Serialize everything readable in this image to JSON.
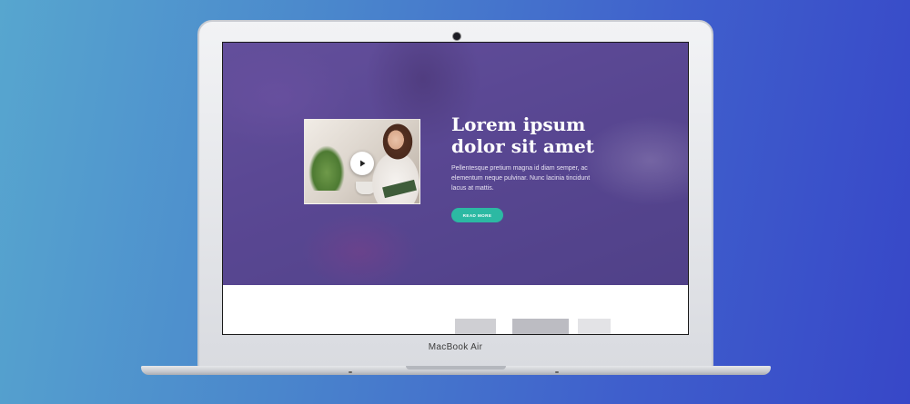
{
  "device": {
    "brand_label": "MacBook Air"
  },
  "hero": {
    "title_line1": "Lorem ipsum",
    "title_line2": "dolor sit amet",
    "body": "Pellentesque pretium magna id diam semper, ac elementum neque pulvinar. Nunc lacinia tincidunt lacus at mattis.",
    "cta_label": "READ MORE",
    "accent_color": "#2cb9a3",
    "overlay_color": "#5b4a93"
  },
  "icons": {
    "play": "play-icon",
    "camera": "camera-icon"
  }
}
